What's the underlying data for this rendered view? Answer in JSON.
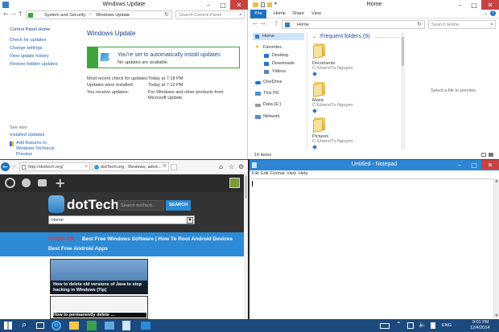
{
  "windows_update": {
    "title": "Windows Update",
    "breadcrumb_1": "System and Security",
    "breadcrumb_sep": "›",
    "breadcrumb_2": "Windows Update",
    "search_placeholder": "Search Control Panel",
    "sidebar": [
      "Control Panel Home",
      "Check for updates",
      "Change settings",
      "View update history",
      "Restore hidden updates"
    ],
    "heading": "Windows Update",
    "status_main": "You're set to automatically install updates",
    "status_sub": "No updates are available.",
    "info_labels": [
      "Most recent check for updates:",
      "Updates were installed:",
      "You receive updates:"
    ],
    "info_values": [
      "Today at 7:18 PM",
      "Today at 7:12 PM",
      "For Windows and other products from Microsoft Update"
    ],
    "see_also": "See also",
    "see_also_links": [
      "Installed Updates",
      "Add features to Windows Technical Preview"
    ]
  },
  "explorer": {
    "title": "Home",
    "ribbon_tabs": [
      "File",
      "Home",
      "Share",
      "View"
    ],
    "address": "Home",
    "search_placeholder": "Search Home",
    "nav": [
      "Home",
      "Favorites",
      "Desktop",
      "Downloads",
      "Videos",
      "OneDrive",
      "This PC",
      "Data (E:)",
      "Network"
    ],
    "section": "Frequent folders (9)",
    "folders": [
      {
        "name": "Documents",
        "path": "C:\\Users\\Tu Nguyen"
      },
      {
        "name": "Music",
        "path": "C:\\Users\\Tu Nguyen"
      },
      {
        "name": "Pictures",
        "path": "C:\\Users\\Tu Nguyen"
      }
    ],
    "preview_text": "Select a file to preview.",
    "status": "16 items"
  },
  "browser": {
    "url": "http://dottech.org/",
    "tab": "dotTech.org - Reviews, advic...",
    "logo": "dotTech",
    "search_placeholder": "Search dotTech...",
    "search_button": "SEARCH",
    "select_value": "Home",
    "popular_label": "POPULAR →",
    "popular_links": [
      "Best Free Windows Software",
      "How To Root Android Devices",
      "Best Free Android Apps"
    ],
    "popular_sep": "|",
    "card_title": "How to delete old versions of Java to stop hacking in Windows [Tip]",
    "card2_title": "How to permanently delete ..."
  },
  "notepad": {
    "title": "Untitled - Notepad",
    "menu": [
      "File",
      "Edit",
      "Format",
      "View",
      "Help"
    ]
  },
  "taskbar": {
    "time": "9:01 PM",
    "date": "12/4/2014",
    "lang": "ENG"
  }
}
